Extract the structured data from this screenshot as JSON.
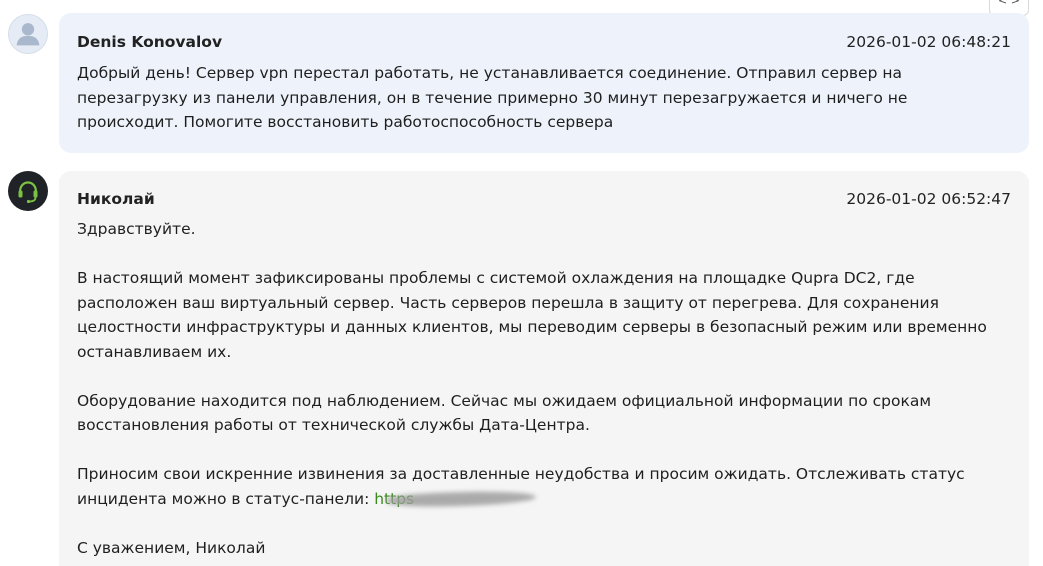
{
  "messages": [
    {
      "role": "customer",
      "author": "Denis Konovalov",
      "timestamp": "2026-01-02 06:48:21",
      "avatar_icon": "user-silhouette-icon",
      "paragraphs": [
        "Добрый день! Сервер vpn перестал работать, не устанавливается соединение. Отправил сервер на перезагрузку из панели управления, он в течение примерно 30 минут перезагружается и ничего не происходит. Помогите восстановить работоспособность сервера"
      ]
    },
    {
      "role": "support",
      "author": "Николай",
      "timestamp": "2026-01-02 06:52:47",
      "avatar_icon": "headset-icon",
      "paragraphs": [
        "Здравствуйте.",
        "В настоящий момент зафиксированы проблемы с системой охлаждения на площадке Qupra DC2, где расположен ваш виртуальный сервер. Часть серверов перешла в защиту от перегрева. Для сохранения целостности инфраструктуры и данных клиентов, мы переводим серверы в безопасный режим или временно останавливаем их.",
        "Оборудование находится под наблюдением. Сейчас мы ожидаем официальной информации по срокам восстановления работы от технической службы Дата-Центра.",
        "Приносим свои искренние извинения за доставленные неудобства и просим ожидать. Отслеживать статус инцидента можно в статус-панели: ",
        "С уважением, Николай"
      ],
      "status_link_visible": "https"
    }
  ],
  "corner_button_icon": "code-brackets-icon",
  "corner_button_label": "< >",
  "colors": {
    "customer_bubble": "#eef3fb",
    "support_bubble": "#f5f5f5",
    "link": "#3a8a1e",
    "support_avatar_bg": "#1f2226",
    "headset_accent": "#7cc242"
  }
}
